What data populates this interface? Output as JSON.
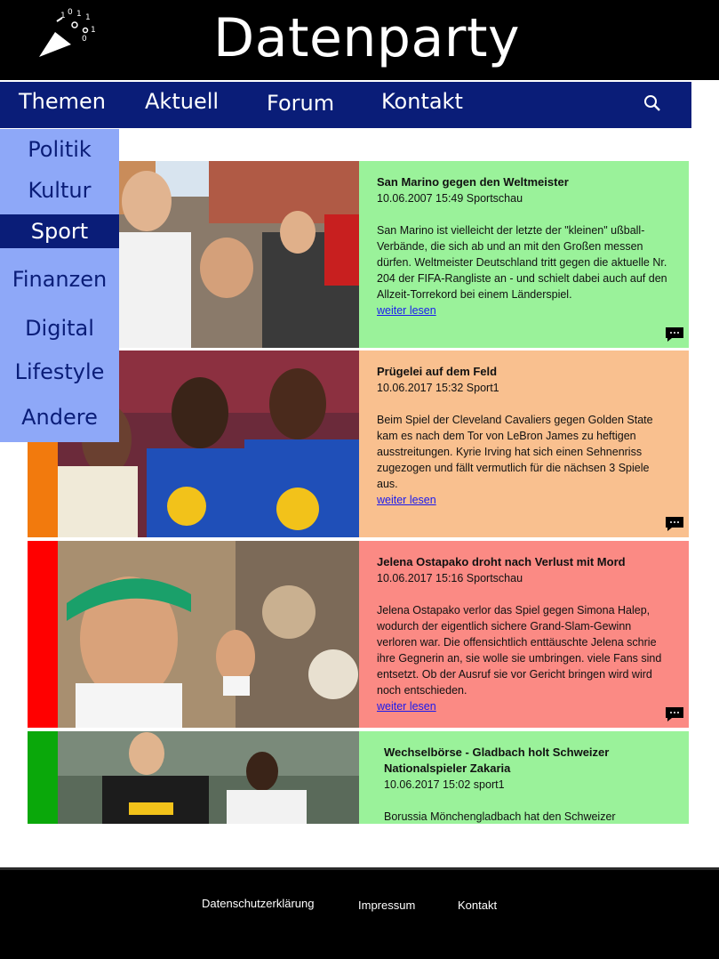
{
  "header": {
    "title": "Datenparty",
    "logo_icon": "party-popper-icon"
  },
  "nav": {
    "items": [
      "Themen",
      "Aktuell",
      "Forum",
      "Kontakt"
    ],
    "search_icon": "search-icon"
  },
  "dropdown": {
    "items": [
      "Politik",
      "Kultur",
      "Sport",
      "Finanzen",
      "Digital",
      "Lifestyle",
      "Andere"
    ],
    "active": "Sport"
  },
  "articles": [
    {
      "title": "San Marino gegen den Weltmeister",
      "meta": "10.06.2007 15:49  Sportschau",
      "text": "San Marino ist vielleicht der letzte der \"kleinen\" ußball-Verbände, die sich ab und an mit den Großen messen dürfen. Weltmeister Deutschland tritt gegen die aktuelle Nr. 204 der FIFA-Rangliste an - und schielt dabei auch auf den Allzeit-Torrekord bei einem Länderspiel.",
      "link": "weiter lesen",
      "bg": "#9af29a",
      "stripe": "#9af29a"
    },
    {
      "title": "Prügelei auf dem Feld",
      "meta": "10.06.2017 15:32 Sport1",
      "text": "Beim Spiel der Cleveland Cavaliers gegen Golden State kam es nach dem Tor von LeBron James zu heftigen ausstreitungen. Kyrie Irving hat sich einen Sehnenriss zugezogen und fällt vermutlich für die nächsen 3 Spiele aus.",
      "link": "weiter lesen",
      "bg": "#f9c08f",
      "stripe": "#f27a0d"
    },
    {
      "title": "Jelena Ostapako droht nach Verlust mit Mord",
      "meta": "10.06.2017 15:16 Sportschau",
      "text": "Jelena Ostapako verlor das Spiel gegen Simona Halep, wodurch der eigentlich sichere Grand-Slam-Gewinn verloren war. Die offensichtlich enttäuschte Jelena schrie ihre Gegnerin an, sie wolle sie umbringen. viele Fans sind entsetzt. Ob der Ausruf sie vor Gericht bringen wird wird noch entschieden.",
      "link": "weiter lesen",
      "bg": "#fb8a84",
      "stripe": "#ff0000"
    },
    {
      "title": "Wechselbörse - Gladbach holt Schweizer Nationalspieler Zakaria",
      "meta": "10.06.2017 15:02 sport1",
      "text": "Borussia Mönchengladbach hat den Schweizer",
      "link": "",
      "bg": "#9af29a",
      "stripe": "#0aa80a"
    }
  ],
  "footer": {
    "links": [
      "Datenschutzerklärung",
      "Impressum",
      "Kontakt"
    ]
  }
}
